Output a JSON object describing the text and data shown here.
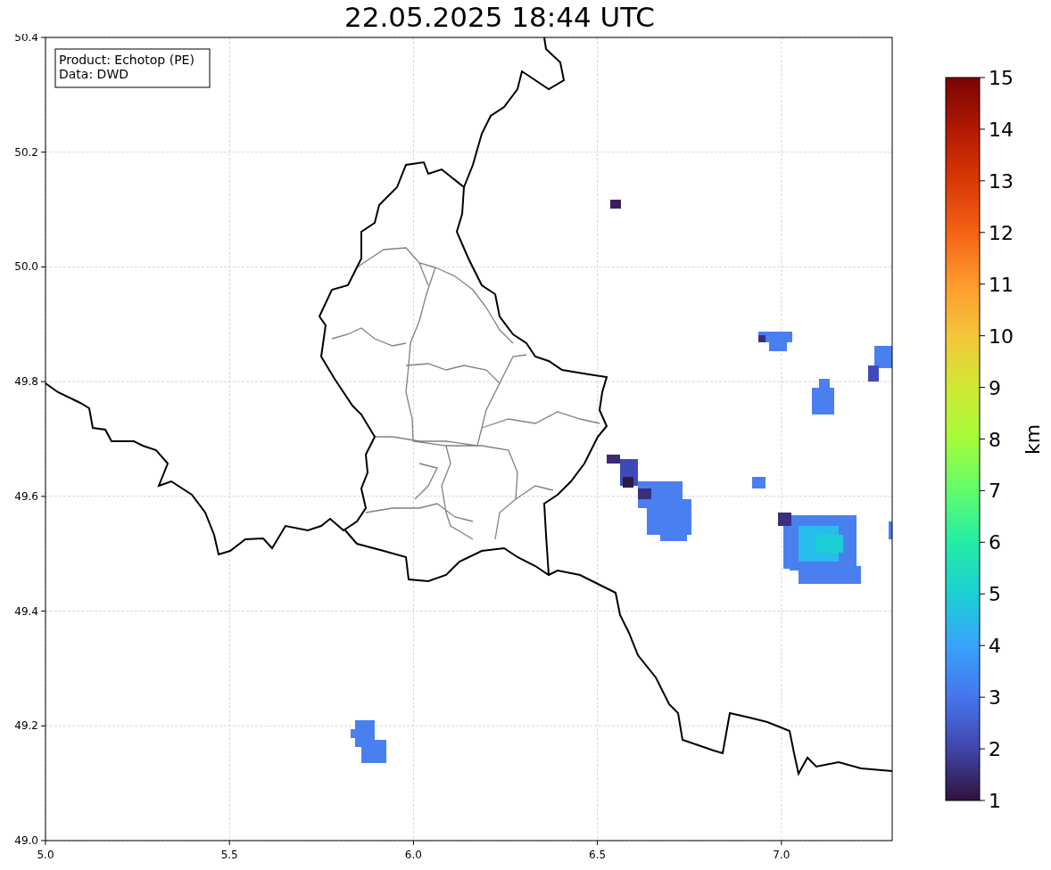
{
  "title": "22.05.2025 18:44 UTC",
  "info_box": [
    "Product: Echotop (PE)",
    "Data: DWD"
  ],
  "x_axis": {
    "ticks": [
      "5.0",
      "5.5",
      "6.0",
      "6.5",
      "7.0"
    ]
  },
  "y_axis": {
    "ticks": [
      "50.4",
      "50.2",
      "50.0",
      "49.8",
      "49.6",
      "49.4",
      "49.2",
      "49.0"
    ]
  },
  "colorbar": {
    "label": "km",
    "ticks": [
      "15",
      "14",
      "13",
      "12",
      "11",
      "10",
      "9",
      "8",
      "7",
      "6",
      "5",
      "4",
      "3",
      "2",
      "1"
    ]
  }
}
